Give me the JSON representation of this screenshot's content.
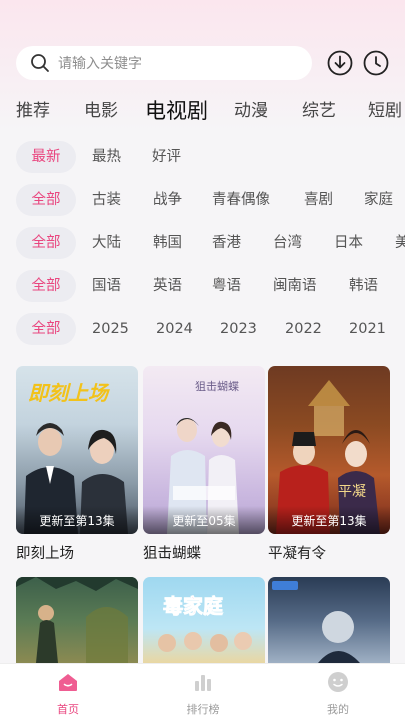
{
  "search": {
    "placeholder": "请输入关键字"
  },
  "header": {
    "download_icon": "download-icon",
    "history_icon": "clock-icon"
  },
  "tabs": [
    "推荐",
    "电影",
    "电视剧",
    "动漫",
    "综艺",
    "短剧"
  ],
  "active_tab": "电视剧",
  "filters": {
    "sort": [
      "最新",
      "最热",
      "好评"
    ],
    "genre": [
      "全部",
      "古装",
      "战争",
      "青春偶像",
      "喜剧",
      "家庭"
    ],
    "region": [
      "全部",
      "大陆",
      "韩国",
      "香港",
      "台湾",
      "日本",
      "美"
    ],
    "language": [
      "全部",
      "国语",
      "英语",
      "粤语",
      "闽南语",
      "韩语"
    ],
    "year": [
      "全部",
      "2025",
      "2024",
      "2023",
      "2022",
      "2021"
    ]
  },
  "selected": {
    "sort": "最新",
    "genre": "全部",
    "region": "全部",
    "language": "全部",
    "year": "全部"
  },
  "shows": [
    {
      "title": "即刻上场",
      "status": "更新至第13集",
      "poster_text": "即刻上场"
    },
    {
      "title": "狙击蝴蝶",
      "status": "更新至05集",
      "poster_text": "狙击蝴蝶"
    },
    {
      "title": "平凝有令",
      "status": "更新至第13集",
      "poster_text": "平凝有令"
    },
    {
      "title": "",
      "status": "",
      "poster_text": ""
    },
    {
      "title": "",
      "status": "",
      "poster_text": "毒家庭"
    },
    {
      "title": "",
      "status": "",
      "poster_text": ""
    }
  ],
  "bottom_nav": [
    {
      "label": "首页",
      "icon": "home-icon",
      "active": true
    },
    {
      "label": "排行榜",
      "icon": "bar-chart-icon",
      "active": false
    },
    {
      "label": "我的",
      "icon": "profile-icon",
      "active": false
    }
  ],
  "colors": {
    "accent": "#e9467f",
    "chip_bg": "#ececf1",
    "page_bg": "#f6f5f7"
  }
}
